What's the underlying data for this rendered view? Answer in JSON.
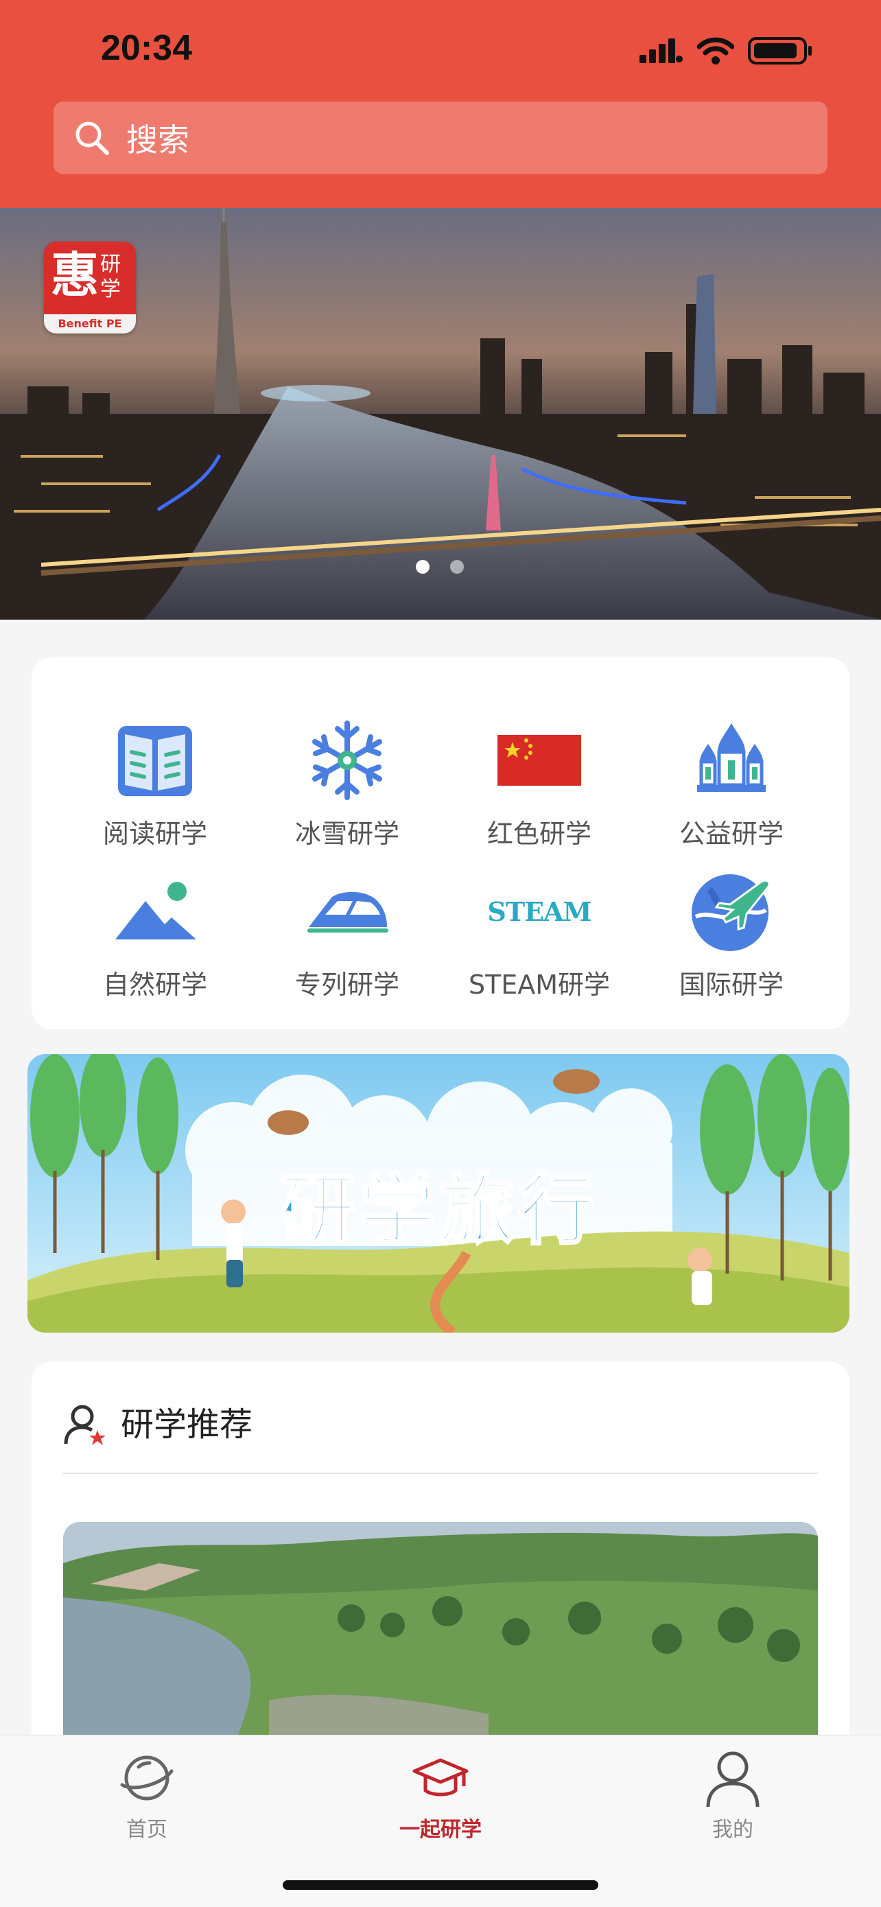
{
  "status_bar": {
    "time": "20:34"
  },
  "search": {
    "placeholder": "搜索",
    "icon": "search-icon"
  },
  "banner": {
    "logo": {
      "main": "惠",
      "side": "研学",
      "sub": "Benefit PE"
    },
    "slide_count": 2,
    "active_slide": 1
  },
  "categories": [
    {
      "label": "阅读研学",
      "icon": "book-icon"
    },
    {
      "label": "冰雪研学",
      "icon": "snowflake-icon"
    },
    {
      "label": "红色研学",
      "icon": "china-flag-icon"
    },
    {
      "label": "公益研学",
      "icon": "palace-icon"
    },
    {
      "label": "自然研学",
      "icon": "mountain-icon"
    },
    {
      "label": "专列研学",
      "icon": "train-icon"
    },
    {
      "label": "STEAM研学",
      "icon": "steam-icon"
    },
    {
      "label": "国际研学",
      "icon": "globe-plane-icon"
    }
  ],
  "promo": {
    "title": "研学旅行"
  },
  "steam_logo_text": "STEAM",
  "recommend": {
    "title": "研学推荐",
    "icon": "user-star-icon"
  },
  "tabbar": {
    "tabs": [
      {
        "label": "首页",
        "icon": "planet-icon",
        "active": false
      },
      {
        "label": "一起研学",
        "icon": "graduation-cap-icon",
        "active": true
      },
      {
        "label": "我的",
        "icon": "person-icon",
        "active": false
      }
    ]
  },
  "colors": {
    "brand_red": "#e9503f",
    "active_tab": "#c0262b",
    "icon_blue": "#4a7fe0"
  }
}
